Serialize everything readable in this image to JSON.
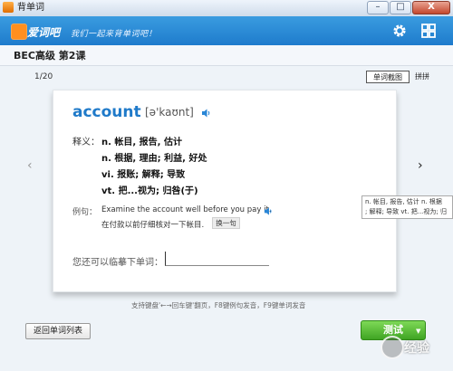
{
  "window": {
    "title": "背单词",
    "min": "–",
    "max": "□",
    "close": "X"
  },
  "header": {
    "logo_text": "爱词吧",
    "slogan": "我们一起来背单词吧！"
  },
  "book": {
    "title": "BEC高级 第2课"
  },
  "progress": {
    "text": "1/20"
  },
  "view_modes": {
    "a": "单词截图",
    "b": "拼拼"
  },
  "entry": {
    "word": "account",
    "phonetic": "[ə'kaʊnt]",
    "definition_label": "释义：",
    "definitions": [
      "n. 帐目, 报告, 估计",
      "n. 根据, 理由; 利益, 好处",
      "vi. 报账; 解释; 导致",
      "vt. 把...视为; 归咎(于)"
    ],
    "example_label": "例句：",
    "example_en": "Examine the account well before you pay it.",
    "example_cn": "在付款以前仔细核对一下帐目.",
    "next_sentence": "换一句"
  },
  "write": {
    "label": "您还可以临摹下单词：",
    "value": ""
  },
  "tooltip": {
    "line1": "n. 帐目, 报告, 估计  n. 根据",
    "line2": "; 解释; 导致  vt. 把...视为; 归"
  },
  "hint": "支持键盘'←→回车键'翻页，F8键例句发音，F9键单词发音",
  "buttons": {
    "back": "返回单词列表",
    "test": "测试"
  },
  "nav": {
    "prev": "‹",
    "next": "›"
  },
  "watermark": {
    "text": "经验"
  },
  "colors": {
    "header_blue": "#1e7bcc",
    "word_blue": "#1f7ac9",
    "test_green": "#3fa423"
  },
  "icons": [
    "app-icon",
    "gear-icon",
    "grid-icon",
    "speaker-icon",
    "prev-arrow-icon",
    "next-arrow-icon",
    "chevron-down-icon"
  ]
}
